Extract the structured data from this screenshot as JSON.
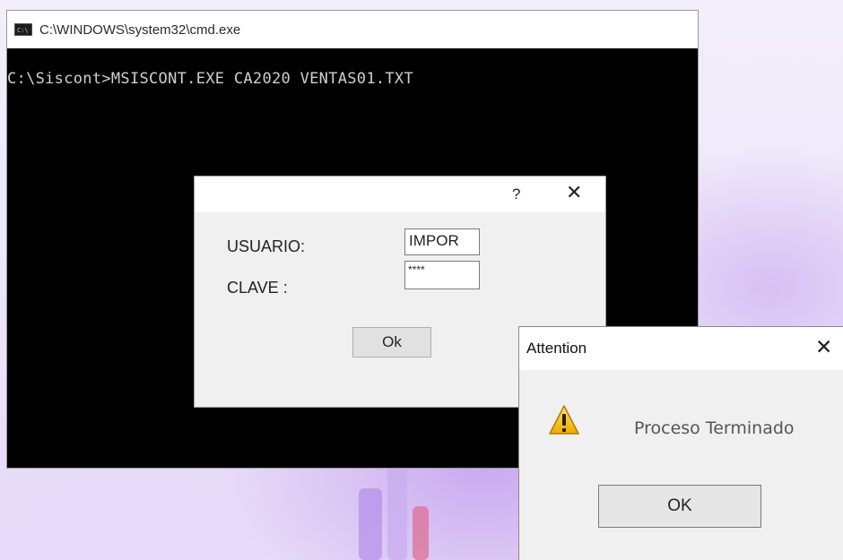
{
  "cmd": {
    "title": "C:\\WINDOWS\\system32\\cmd.exe",
    "icon_text": "C:\\",
    "command_line": "C:\\Siscont>MSISCONT.EXE CA2020 VENTAS01.TXT"
  },
  "login_dialog": {
    "help_label": "?",
    "close_label": "✕",
    "usuario_label": "USUARIO:",
    "clave_label": "CLAVE  :",
    "usuario_value": "IMPOR",
    "clave_value": "****",
    "ok_label": "Ok"
  },
  "attention_dialog": {
    "title": "Attention",
    "close_label": "✕",
    "message": "Proceso Terminado",
    "icon": "warning-icon",
    "ok_label": "OK"
  },
  "colors": {
    "console_bg": "#000000",
    "console_text": "#cfcfcf",
    "dialog_bg": "#f0f0f0",
    "warning_yellow": "#f5c400"
  }
}
